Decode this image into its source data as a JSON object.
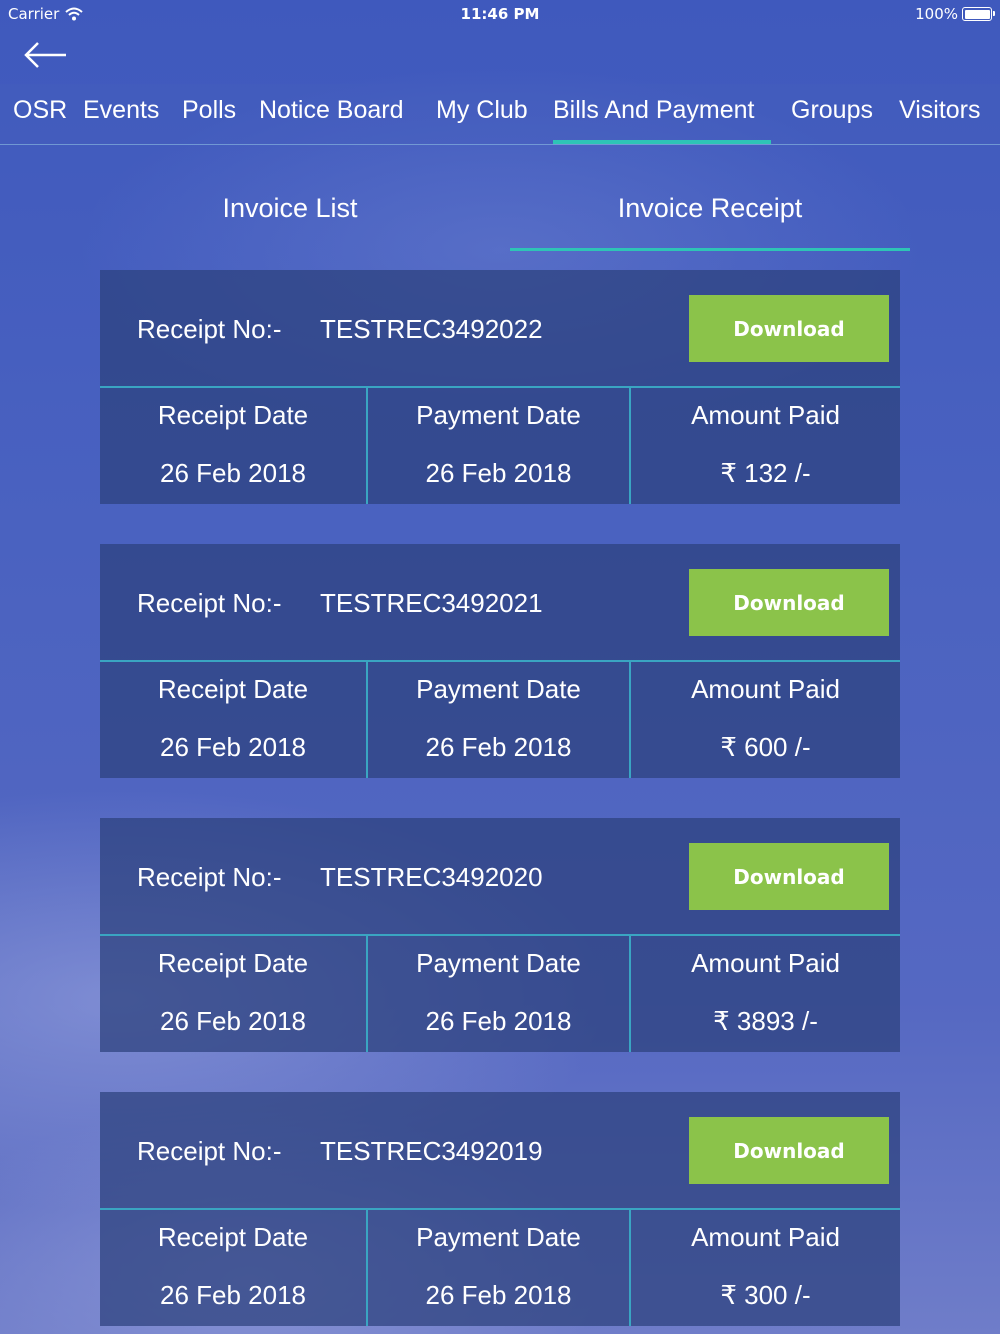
{
  "status_bar": {
    "carrier": "Carrier",
    "time": "11:46 PM",
    "battery": "100%"
  },
  "nav": {
    "back_icon": "arrow-left-icon",
    "tabs": [
      {
        "label": "OSR"
      },
      {
        "label": "Events"
      },
      {
        "label": "Polls"
      },
      {
        "label": "Notice Board"
      },
      {
        "label": "My Club"
      },
      {
        "label": "Bills And Payment"
      },
      {
        "label": "Groups"
      },
      {
        "label": "Visitors"
      }
    ],
    "active_tab": "Bills And Payment"
  },
  "subtabs": {
    "invoice_list": "Invoice List",
    "invoice_receipt": "Invoice Receipt",
    "active": "Invoice Receipt"
  },
  "colors": {
    "accent": "#2ec4b6",
    "download_button": "#8bc34a",
    "card_bg": "#2d417d",
    "divider": "#3aa5c2"
  },
  "receipts": [
    {
      "receipt_label": "Receipt No:-",
      "receipt_no": "TESTREC3492022",
      "download_label": "Download",
      "receipt_date_label": "Receipt Date",
      "receipt_date": "26 Feb 2018",
      "payment_date_label": "Payment Date",
      "payment_date": "26 Feb 2018",
      "amount_label": "Amount Paid",
      "amount": "₹ 132 /-"
    },
    {
      "receipt_label": "Receipt No:-",
      "receipt_no": "TESTREC3492021",
      "download_label": "Download",
      "receipt_date_label": "Receipt Date",
      "receipt_date": "26 Feb 2018",
      "payment_date_label": "Payment Date",
      "payment_date": "26 Feb 2018",
      "amount_label": "Amount Paid",
      "amount": "₹ 600 /-"
    },
    {
      "receipt_label": "Receipt No:-",
      "receipt_no": "TESTREC3492020",
      "download_label": "Download",
      "receipt_date_label": "Receipt Date",
      "receipt_date": "26 Feb 2018",
      "payment_date_label": "Payment Date",
      "payment_date": "26 Feb 2018",
      "amount_label": "Amount Paid",
      "amount": "₹ 3893 /-"
    },
    {
      "receipt_label": "Receipt No:-",
      "receipt_no": "TESTREC3492019",
      "download_label": "Download",
      "receipt_date_label": "Receipt Date",
      "receipt_date": "26 Feb 2018",
      "payment_date_label": "Payment Date",
      "payment_date": "26 Feb 2018",
      "amount_label": "Amount Paid",
      "amount": "₹ 300 /-"
    }
  ]
}
